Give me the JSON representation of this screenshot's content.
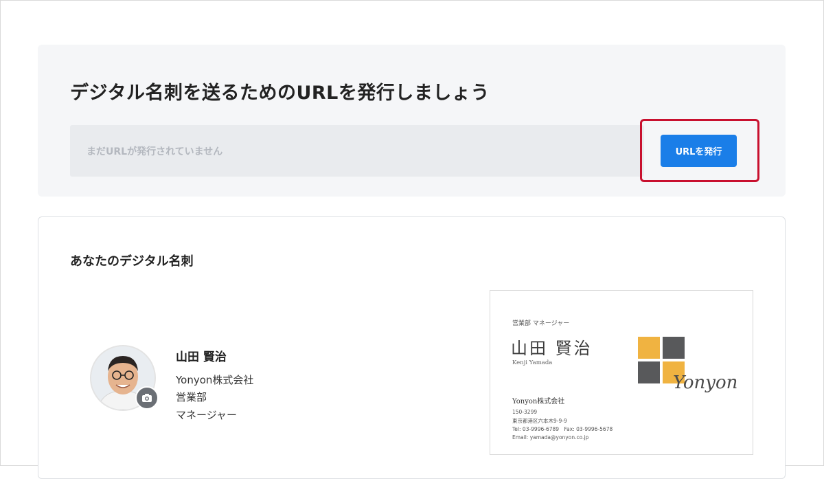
{
  "url_panel": {
    "title": "デジタル名刺を送るためのURLを発行しましょう",
    "url_field_placeholder": "まだURLが発行されていません",
    "issue_button_label": "URLを発行",
    "highlight_color": "#c8102e",
    "button_color": "#1a7ee8"
  },
  "card_panel": {
    "heading": "あなたのデジタル名刺",
    "profile": {
      "name": "山田 賢治",
      "company": "Yonyon株式会社",
      "department": "営業部",
      "position": "マネージャー",
      "avatar_icon": "person-photo",
      "camera_icon": "camera-icon"
    },
    "business_card": {
      "title": "営業部 マネージャー",
      "name": "山田 賢治",
      "romaji": "Kenji Yamada",
      "logo_text": "Yonyon",
      "logo_colors": [
        "#f0b341",
        "#58595b"
      ],
      "company": "Yonyon株式会社",
      "postal": "150-3299",
      "address": "東京都港区六本木9-9-9",
      "tel_fax": "Tel: 03-9996-6789　Fax: 03-9996-5678",
      "email": "Email: yamada@yonyon.co.jp"
    }
  }
}
